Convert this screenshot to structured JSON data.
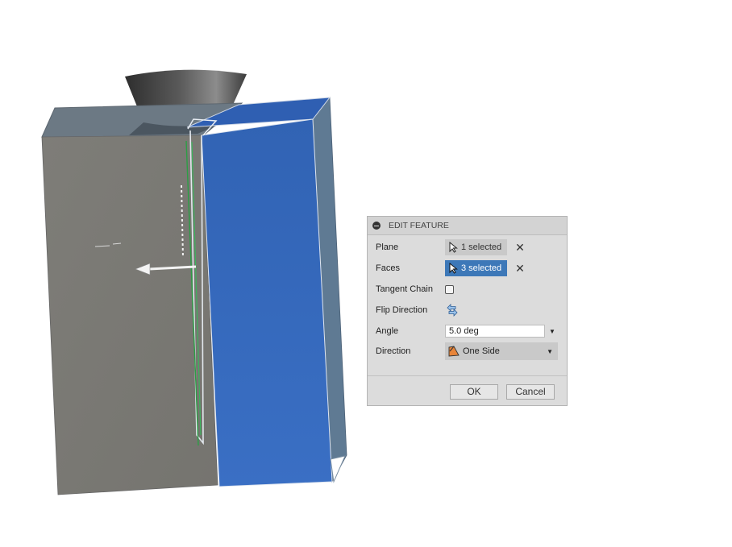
{
  "viewport": {
    "model_colors": {
      "gray_face": "#7a7a75",
      "blue_face": "#3a6cbf",
      "top_face": "#6d7a86",
      "funnel": "#3e3e3e"
    },
    "icons": [
      "direction-arrow",
      "parting-line",
      "funnel-shape"
    ]
  },
  "panel": {
    "title": "EDIT FEATURE",
    "rows": {
      "plane": {
        "label": "Plane",
        "value": "1 selected"
      },
      "faces": {
        "label": "Faces",
        "value": "3 selected"
      },
      "tangent": {
        "label": "Tangent Chain",
        "checked": false
      },
      "flip": {
        "label": "Flip Direction"
      },
      "angle": {
        "label": "Angle",
        "value": "5.0 deg"
      },
      "direction": {
        "label": "Direction",
        "value": "One Side"
      }
    },
    "ok_label": "OK",
    "cancel_label": "Cancel",
    "accent_color": "#3d78b8"
  }
}
